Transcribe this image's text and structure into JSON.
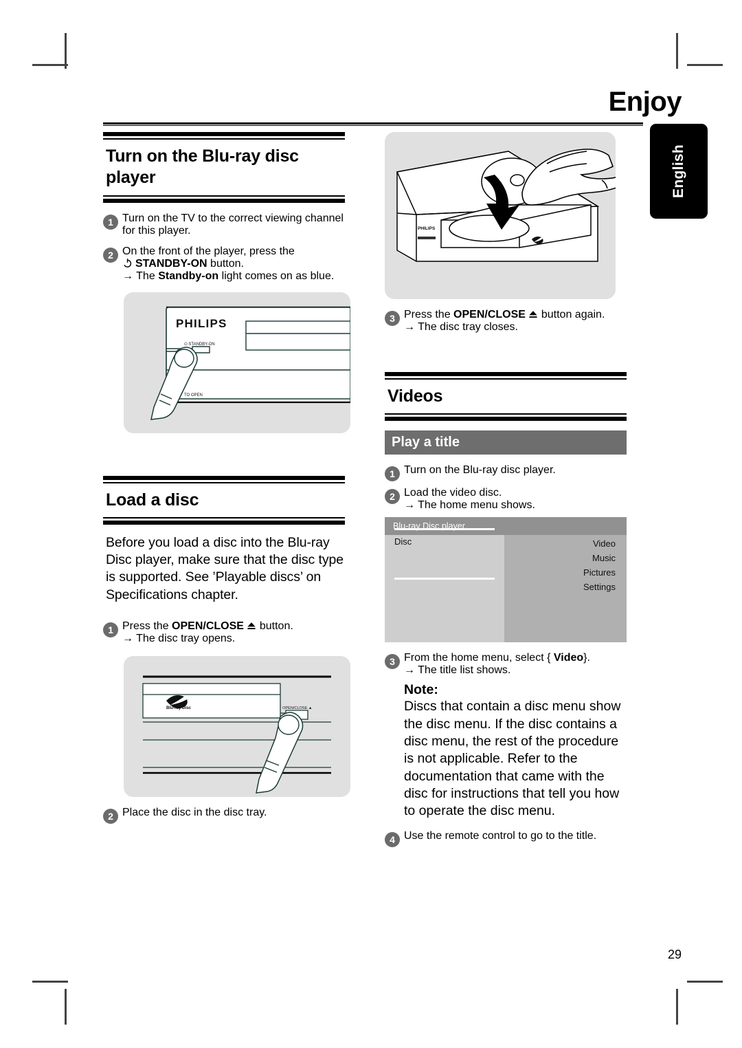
{
  "header": {
    "chapter_title": "Enjoy",
    "language_tab": "English"
  },
  "page_number": "29",
  "left_column": {
    "section1": {
      "heading": "Turn on the Blu-ray disc player",
      "steps": [
        {
          "num": "1",
          "text": "Turn on the TV to the correct viewing channel for this player."
        },
        {
          "num": "2",
          "text_before": "On the front of the player, press the",
          "power_icon": "standby-power-icon",
          "bold": "STANDBY-ON",
          "text_after": "button.",
          "result_arrow": "→",
          "result_before": "The",
          "result_bold": "Standby-on",
          "result_after": "light comes on as blue."
        }
      ],
      "figure": {
        "name": "player-front-standby-figure",
        "brand": "PHILIPS",
        "label_standby": "STANDBY-ON",
        "label_open": "TO OPEN"
      }
    },
    "section2": {
      "heading": "Load a disc",
      "paragraph": "Before you load a disc into the Blu-ray Disc player, make sure that the disc type is supported. See ’Playable discs’ on Specifications chapter.",
      "steps": [
        {
          "num": "1",
          "text_before": "Press the",
          "bold": "OPEN/CLOSE",
          "eject_icon": "eject-icon",
          "text_after": "button.",
          "result_arrow": "→",
          "result": "The disc tray opens."
        },
        {
          "num": "2",
          "text": "Place the disc in the disc tray."
        }
      ],
      "figure": {
        "name": "player-front-open-close-figure",
        "disc_logo": "Blu-ray Disc",
        "label_open_close": "OPEN/CLOSE"
      }
    }
  },
  "right_column": {
    "figure_top": {
      "name": "disc-loading-tray-figure",
      "brand": "PHILIPS",
      "disc_logo": "Blu-ray Disc"
    },
    "step3": {
      "num": "3",
      "text_before": "Press the",
      "bold": "OPEN/CLOSE",
      "eject_icon": "eject-icon",
      "text_after": "button again.",
      "result_arrow": "→",
      "result": "The disc tray closes."
    },
    "section_videos": {
      "heading": "Videos",
      "subhead_bar": "Play a title",
      "steps": [
        {
          "num": "1",
          "text": "Turn on the Blu-ray disc player."
        },
        {
          "num": "2",
          "text": "Load the video disc.",
          "result_arrow": "→",
          "result": "The home menu shows."
        }
      ],
      "osd": {
        "title": "Blu-ray Disc player",
        "source_label": "Disc",
        "items": [
          "Video",
          "Music",
          "Pictures",
          "Settings"
        ]
      },
      "step3": {
        "num": "3",
        "text_before": "From the home menu, select {",
        "bold": "Video",
        "text_after": "}.",
        "result_arrow": "→",
        "result": "The title list shows."
      },
      "note": {
        "title": "Note:",
        "body": "Discs that contain a disc menu show the disc menu. If the disc contains a disc menu, the rest of the procedure is not applicable. Refer to the documentation that came with the disc for instructions that tell you how to operate the disc menu."
      },
      "step4": {
        "num": "4",
        "text": "Use the remote control to go to the title."
      }
    }
  },
  "colors": {
    "rule": "#000000",
    "step_number_bg": "#6b6b6b",
    "subhead_bar_bg": "#6e6e6e",
    "figure_bg": "#e0e0e0",
    "osd_title_bg": "#919191",
    "osd_left_bg": "#cecece",
    "osd_right_bg": "#b0b0b0",
    "language_tab_bg": "#000000"
  }
}
